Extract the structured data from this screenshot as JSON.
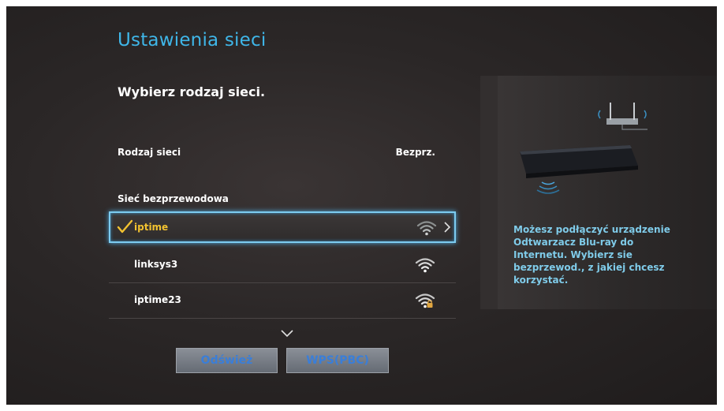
{
  "header": {
    "title": "Ustawienia sieci"
  },
  "prompt": "Wybierz rodzaj sieci.",
  "network_type": {
    "label": "Rodzaj sieci",
    "value": "Bezprz."
  },
  "group_label": "Sieć bezprzewodowa",
  "networks": [
    {
      "name": "iptime",
      "selected": true,
      "secured": false,
      "icon": "wifi-icon"
    },
    {
      "name": "linksys3",
      "selected": false,
      "secured": false,
      "icon": "wifi-icon"
    },
    {
      "name": "iptime23",
      "selected": false,
      "secured": true,
      "icon": "wifi-locked-icon"
    }
  ],
  "buttons": {
    "refresh": "Odśwież",
    "wps": "WPS(PBC)"
  },
  "help_text": "Możesz podłączyć urządzenie Odtwarzacz Blu-ray do Internetu. Wybierz sie bezprzewod., z jakiej chcesz korzystać.",
  "colors": {
    "title": "#3fb6e8",
    "selected_text": "#f2c230",
    "focus_border": "#7ccbf0",
    "help_text": "#7fcbe9",
    "button_text": "#3a7ed8"
  }
}
